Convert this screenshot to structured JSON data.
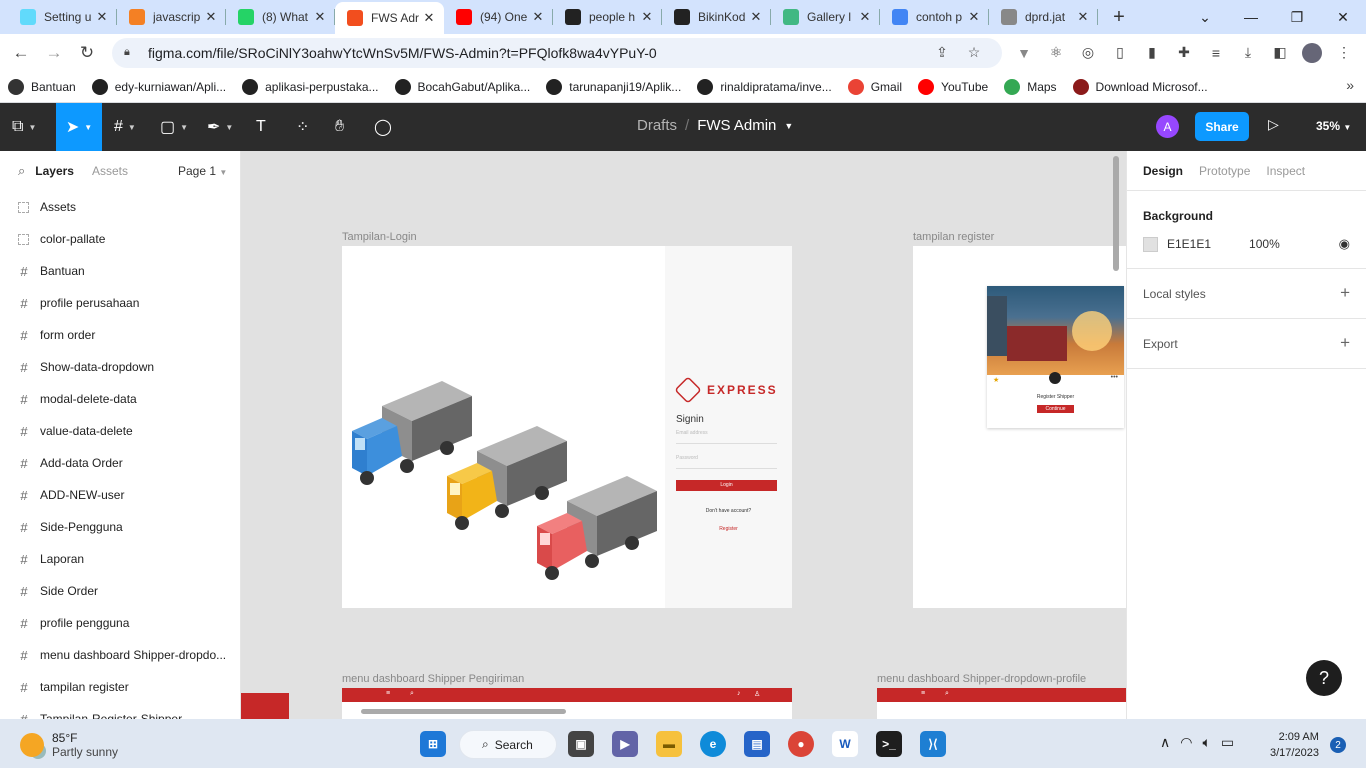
{
  "browser": {
    "tabs": [
      {
        "title": "Setting u",
        "favicon": "react-icon",
        "color": "#61dafb"
      },
      {
        "title": "javascrip",
        "favicon": "stack-icon",
        "color": "#f48024"
      },
      {
        "title": "(8) What",
        "favicon": "whatsapp-icon",
        "color": "#25d366"
      },
      {
        "title": "FWS Adr",
        "favicon": "figma-icon",
        "color": "#f24e1e"
      },
      {
        "title": "(94) One",
        "favicon": "youtube-icon",
        "color": "#ff0000"
      },
      {
        "title": "people h",
        "favicon": "people-icon",
        "color": "#222222"
      },
      {
        "title": "BikinKod",
        "favicon": "github-icon",
        "color": "#222222"
      },
      {
        "title": "Gallery l",
        "favicon": "vue-icon",
        "color": "#41b883"
      },
      {
        "title": "contoh p",
        "favicon": "google-icon",
        "color": "#4285f4"
      },
      {
        "title": "dprd.jat",
        "favicon": "globe-icon",
        "color": "#888888"
      }
    ],
    "url": "figma.com/file/SRoCiNlY3oahwYtcWnSv5M/FWS-Admin?t=PFQlofk8wa4vYPuY-0",
    "bookmarks": [
      {
        "label": "Bantuan",
        "icon": "globe-icon",
        "color": "#333333"
      },
      {
        "label": "edy-kurniawan/Apli...",
        "icon": "github-icon",
        "color": "#222222"
      },
      {
        "label": "aplikasi-perpustaka...",
        "icon": "github-icon",
        "color": "#222222"
      },
      {
        "label": "BocahGabut/Aplika...",
        "icon": "github-icon",
        "color": "#222222"
      },
      {
        "label": "tarunapanji19/Aplik...",
        "icon": "github-icon",
        "color": "#222222"
      },
      {
        "label": "rinaldipratama/inve...",
        "icon": "github-icon",
        "color": "#222222"
      },
      {
        "label": "Gmail",
        "icon": "gmail-icon",
        "color": "#ea4335"
      },
      {
        "label": "YouTube",
        "icon": "youtube-icon",
        "color": "#ff0000"
      },
      {
        "label": "Maps",
        "icon": "maps-icon",
        "color": "#34a853"
      },
      {
        "label": "Download Microsof...",
        "icon": "y-icon",
        "color": "#8b1a1a"
      }
    ]
  },
  "figma": {
    "drafts": "Drafts",
    "file_name": "FWS Admin",
    "avatar_initial": "A",
    "share_label": "Share",
    "zoom": "35%",
    "left_tabs": {
      "layers": "Layers",
      "assets": "Assets",
      "page": "Page 1"
    },
    "layers": [
      {
        "name": "Assets",
        "type": "component"
      },
      {
        "name": "color-pallate",
        "type": "component"
      },
      {
        "name": "Bantuan",
        "type": "frame"
      },
      {
        "name": "profile perusahaan",
        "type": "frame"
      },
      {
        "name": "form order",
        "type": "frame"
      },
      {
        "name": "Show-data-dropdown",
        "type": "frame"
      },
      {
        "name": "modal-delete-data",
        "type": "frame"
      },
      {
        "name": "value-data-delete",
        "type": "frame"
      },
      {
        "name": "Add-data Order",
        "type": "frame"
      },
      {
        "name": "ADD-NEW-user",
        "type": "frame"
      },
      {
        "name": "Side-Pengguna",
        "type": "frame"
      },
      {
        "name": "Laporan",
        "type": "frame"
      },
      {
        "name": "Side Order",
        "type": "frame"
      },
      {
        "name": "profile pengguna",
        "type": "frame"
      },
      {
        "name": "menu dashboard Shipper-dropdo...",
        "type": "frame"
      },
      {
        "name": "tampilan register",
        "type": "frame"
      },
      {
        "name": "Tampilan-Register-Shipper",
        "type": "frame"
      }
    ],
    "canvas": {
      "background": "#e1e1e1",
      "frames": {
        "login": "Tampilan-Login",
        "register": "tampilan register",
        "dash1": "menu dashboard Shipper Pengiriman",
        "dash2": "menu dashboard Shipper-dropdown-profile"
      },
      "login": {
        "logo": "EXPRESS",
        "signin": "Signin",
        "email_placeholder": "Email address",
        "password_placeholder": "Password",
        "login_btn": "Login",
        "no_account": "Don't have account?",
        "register": "Register"
      },
      "register_card": {
        "title": "Register Shipper",
        "button": "Continue"
      }
    },
    "right_tabs": {
      "design": "Design",
      "prototype": "Prototype",
      "inspect": "Inspect"
    },
    "background_section": {
      "title": "Background",
      "hex": "E1E1E1",
      "opacity": "100%"
    },
    "local_styles": "Local styles",
    "export": "Export",
    "help": "?"
  },
  "taskbar": {
    "temp": "85°F",
    "weather": "Partly sunny",
    "search": "Search",
    "time": "2:09 AM",
    "date": "3/17/2023",
    "notifications": "2"
  }
}
